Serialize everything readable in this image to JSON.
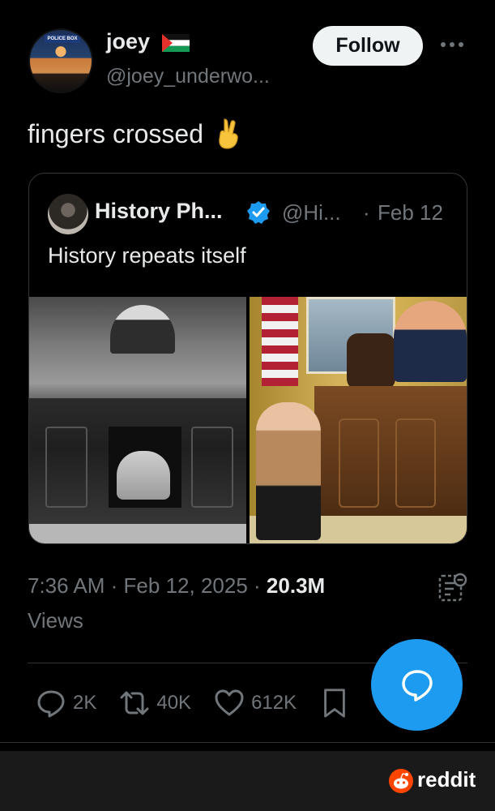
{
  "author": {
    "display_name": "joey",
    "handle": "@joey_underwo...",
    "follow_label": "Follow",
    "flag_icon": "palestine-flag-icon",
    "avatar_text": "POLICE BOX"
  },
  "post": {
    "text": "fingers crossed",
    "emoji_icon": "crossed-fingers-icon"
  },
  "quote": {
    "display_name": "History Ph...",
    "handle": "@Hi...",
    "separator": "·",
    "date": "Feb 12",
    "text": "History repeats itself"
  },
  "meta": {
    "time": "7:36 AM",
    "sep1": "·",
    "date": "Feb 12, 2025",
    "sep2": "·",
    "views_count": "20.3M",
    "views_label": "Views"
  },
  "actions": {
    "replies": "2K",
    "reposts": "40K",
    "likes": "612K"
  },
  "footer": {
    "brand": "reddit"
  },
  "colors": {
    "accent": "#1d9bf0",
    "background": "#000000",
    "text": "#e7e9ea",
    "muted": "#71767b",
    "reddit_orange": "#ff4500"
  }
}
